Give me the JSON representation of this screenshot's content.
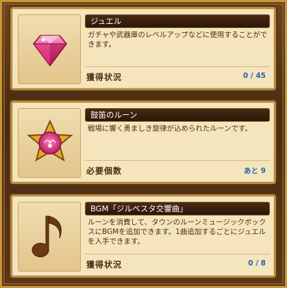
{
  "cards": [
    {
      "title": "ジュエル",
      "description": "ガチャや武器庫のレベルアップなどに使用することができます。",
      "footer_label": "獲得状況",
      "footer_value": "0 / 45",
      "icon": "pink-gem-icon"
    },
    {
      "title": "鼓笛のルーン",
      "description": "戦場に響く勇ましき旋律が込められたルーンです。",
      "footer_label": "必要個数",
      "footer_value": "あと 9",
      "icon": "rune-star-icon"
    },
    {
      "title": "BGM「ジルベスタ交響曲」",
      "description": "ルーンを消費して、タウンのルーンミュージックボックスにBGMを追加できます。1曲追加するごとにジュエルを入手できます。",
      "footer_label": "獲得状況",
      "footer_value": "0 / 8",
      "icon": "music-note-icon"
    }
  ],
  "colors": {
    "frame_gold": "#c99836",
    "card_bg": "#f4e5bd",
    "title_bar": "#2a170a",
    "value_blue": "#2a5fae"
  }
}
